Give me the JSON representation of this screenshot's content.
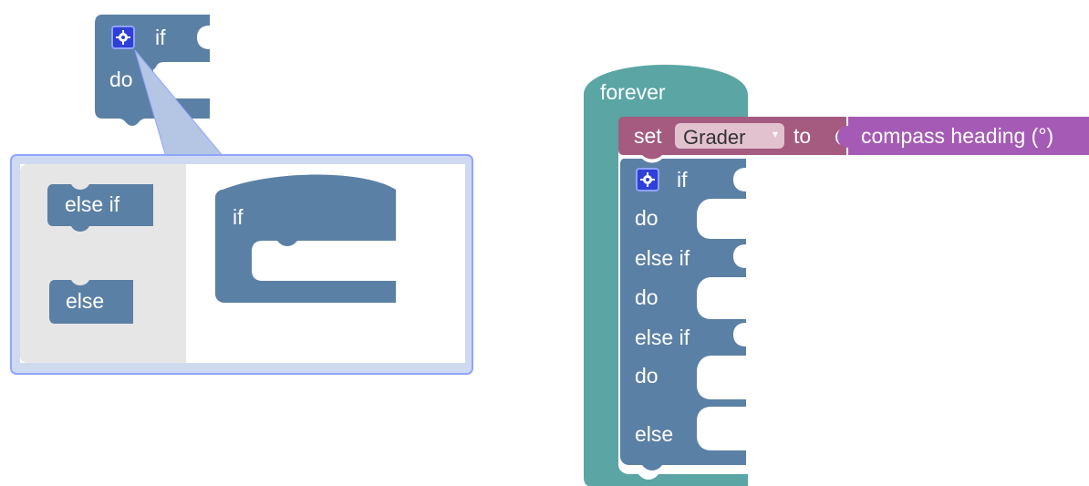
{
  "colors": {
    "logic_block": "#5b80a5",
    "loop_block": "#5ba5a5",
    "variable_block": "#a55b80",
    "sensor_block": "#a55bb5",
    "mutator_bg": "#e6e6e6",
    "mutator_border": "#8fa5ff",
    "gear": "#2f3fd8"
  },
  "mutator_block": {
    "if_label": "if",
    "do_label": "do",
    "gear_icon": "gear-icon"
  },
  "mutator_flyout": {
    "else_if_label": "else if",
    "else_label": "else"
  },
  "mutator_workspace": {
    "if_label": "if"
  },
  "program": {
    "forever_label": "forever",
    "set_label": "set",
    "variable_name": "Grader",
    "dropdown_arrow": "▾",
    "to_label": "to",
    "sensor_label": "compass heading (°)",
    "if_label": "if",
    "do_label_1": "do",
    "else_if_label_1": "else if",
    "do_label_2": "do",
    "else_if_label_2": "else if",
    "do_label_3": "do",
    "else_label": "else"
  }
}
